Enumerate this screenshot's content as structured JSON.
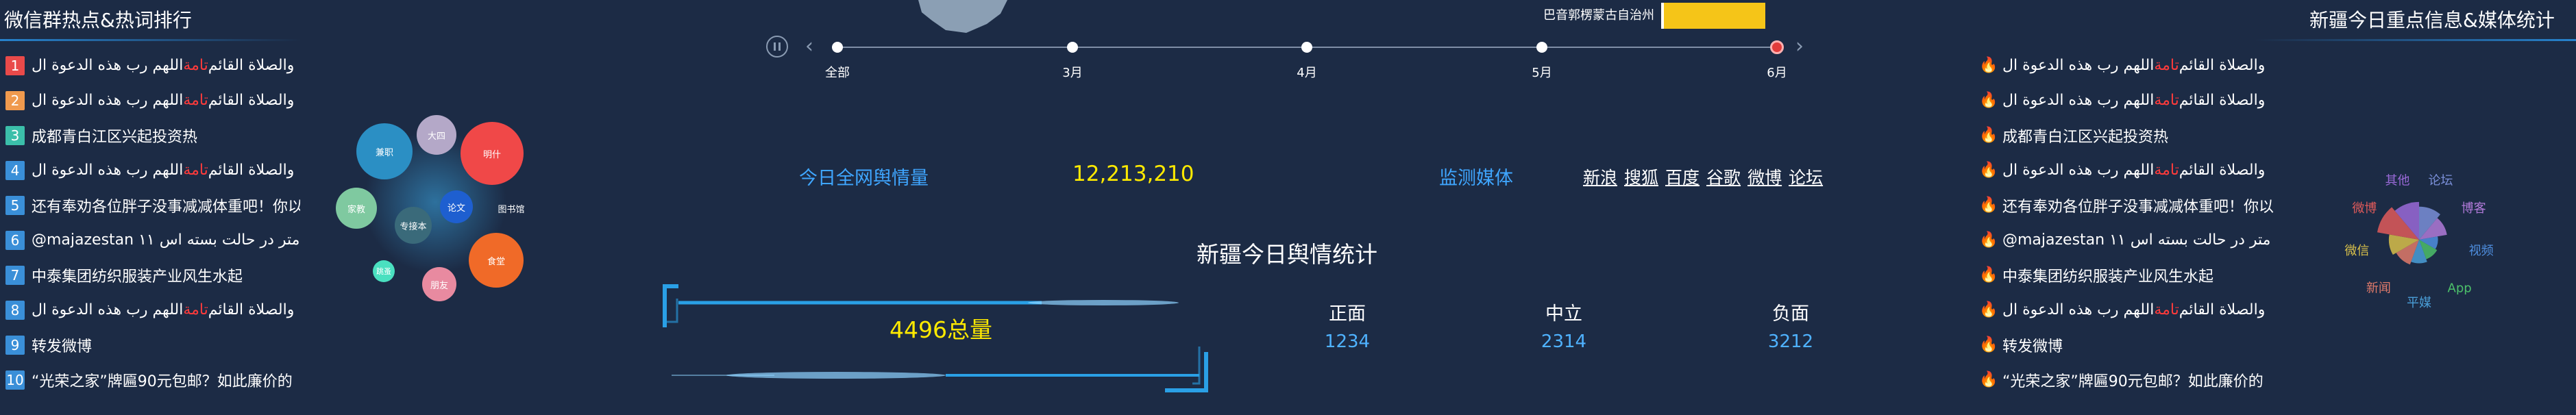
{
  "left_panel": {
    "title": "微信群热点&热词排行",
    "items": [
      {
        "rank": "1",
        "pre": "اللهم رب هذه الدعوة ال",
        "hl": "تامة",
        "post": " والصلاة القائم"
      },
      {
        "rank": "2",
        "pre": "اللهم رب هذه الدعوة ال",
        "hl": "تامة",
        "post": " والصلاة القائم"
      },
      {
        "rank": "3",
        "pre": "成都青白江区兴起投资热",
        "hl": "",
        "post": ""
      },
      {
        "rank": "4",
        "pre": "اللهم رب هذه الدعوة ال",
        "hl": "تامة",
        "post": " والصلاة القائم"
      },
      {
        "rank": "5",
        "pre": "还有奉劝各位胖子没事减减体重吧！你以",
        "hl": "",
        "post": ""
      },
      {
        "rank": "6",
        "pre": "@majazestan ۱۱ متر در حالت بسته اس",
        "hl": "",
        "post": ""
      },
      {
        "rank": "7",
        "pre": "中泰集团纺织服装产业风生水起",
        "hl": "",
        "post": ""
      },
      {
        "rank": "8",
        "pre": "اللهم رب هذه الدعوة ال",
        "hl": "تامة",
        "post": " والصلاة القائم"
      },
      {
        "rank": "9",
        "pre": "转发微博",
        "hl": "",
        "post": ""
      },
      {
        "rank": "10",
        "pre": "“光荣之家”牌匾90元包邮？如此廉价的",
        "hl": "",
        "post": ""
      }
    ]
  },
  "word_cloud": {
    "bubbles": [
      "兼职",
      "大四",
      "明什",
      "论文",
      "专接本",
      "家教",
      "图书馆",
      "食堂",
      "跳蚤",
      "朋友"
    ]
  },
  "map": {
    "region_label": "巴音郭楞蒙古自治州",
    "legend_color": "#f5c518"
  },
  "timeline": {
    "pause_icon": "pause-icon",
    "labels": [
      "全部",
      "3月",
      "4月",
      "5月",
      "6月"
    ],
    "active_index": 4
  },
  "today": {
    "label": "今日全网舆情量",
    "value": "12,213,210"
  },
  "monitor": {
    "label": "监测媒体",
    "links": [
      "新浪",
      "搜狐",
      "百度",
      "谷歌",
      "微博",
      "论坛"
    ]
  },
  "stats": {
    "title": "新疆今日舆情统计",
    "total_text": "4496总量",
    "columns": [
      {
        "label": "正面",
        "value": "1234"
      },
      {
        "label": "中立",
        "value": "2314"
      },
      {
        "label": "负面",
        "value": "3212"
      }
    ]
  },
  "right_panel": {
    "title": "新疆今日重点信息&媒体统计",
    "items": [
      {
        "pre": "اللهم رب هذه الدعوة ال",
        "hl": "تامة",
        "post": " والصلاة القائم"
      },
      {
        "pre": "اللهم رب هذه الدعوة ال",
        "hl": "تامة",
        "post": " والصلاة القائم"
      },
      {
        "pre": "成都青白江区兴起投资热",
        "hl": "",
        "post": ""
      },
      {
        "pre": "اللهم رب هذه الدعوة ال",
        "hl": "تامة",
        "post": " والصلاة القائم"
      },
      {
        "pre": "还有奉劝各位胖子没事减减体重吧！你以",
        "hl": "",
        "post": ""
      },
      {
        "pre": "@majazestan ۱۱ متر در حالت بسته اس",
        "hl": "",
        "post": ""
      },
      {
        "pre": "中泰集团纺织服装产业风生水起",
        "hl": "",
        "post": ""
      },
      {
        "pre": "اللهم رب هذه الدعوة ال",
        "hl": "تامة",
        "post": " والصلاة القائم"
      },
      {
        "pre": "转发微博",
        "hl": "",
        "post": ""
      },
      {
        "pre": "“光荣之家”牌匾90元包邮？如此廉价的",
        "hl": "",
        "post": ""
      }
    ]
  },
  "chart_data": {
    "type": "rose",
    "categories": [
      "论坛",
      "博客",
      "视频",
      "App",
      "平媒",
      "新闻",
      "微信",
      "微博",
      "其他"
    ],
    "colors": [
      "#7a8fd8",
      "#b07ad8",
      "#4f8fe0",
      "#4cc06a",
      "#4a9fd8",
      "#e07a6a",
      "#d8c04a",
      "#e05a5a",
      "#9a6ad8"
    ],
    "values": [
      35,
      30,
      20,
      22,
      25,
      28,
      32,
      45,
      40
    ]
  }
}
